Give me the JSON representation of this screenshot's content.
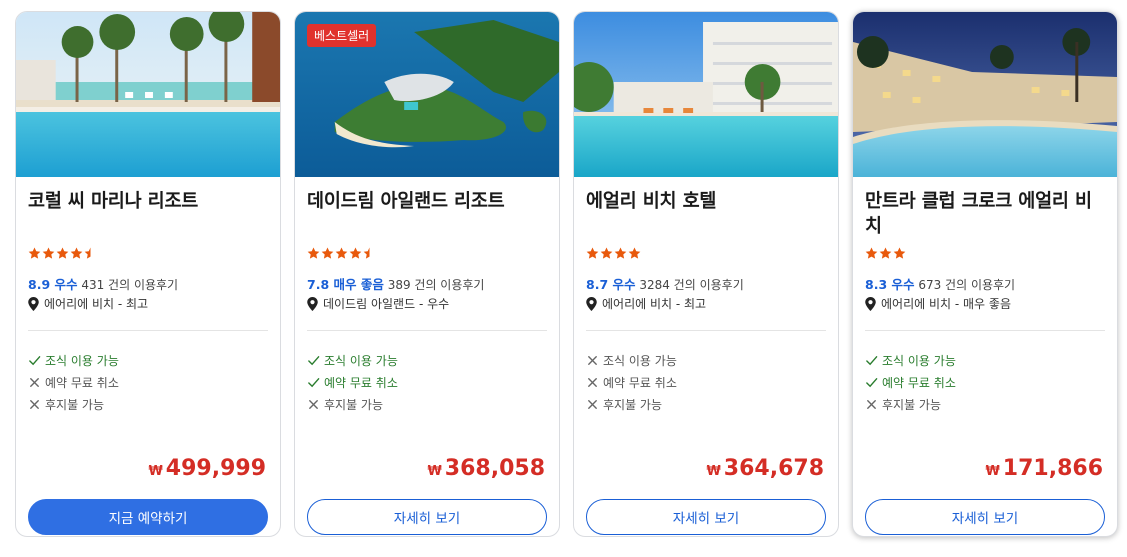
{
  "colors": {
    "accent": "#1a5fd6",
    "price": "#d42d25",
    "star": "#e8590c",
    "ok": "#2a7d2e",
    "badge": "#e0322d"
  },
  "cards": [
    {
      "title": "코럴 씨 마리나 리조트",
      "badge": "",
      "stars": 4.5,
      "score": "8.9 우수",
      "reviews": "431 건의 이용후기",
      "location": "에어리에 비치 - 최고",
      "features": [
        {
          "icon": "check-icon",
          "label": "조식 이용 가능"
        },
        {
          "icon": "x-icon",
          "label": "예약 무료 취소"
        },
        {
          "icon": "x-icon",
          "label": "후지불 가능"
        }
      ],
      "currency": "₩",
      "price": "499,999",
      "button": "지금 예약하기"
    },
    {
      "title": "데이드림 아일랜드 리조트",
      "badge": "베스트셀러",
      "stars": 4.5,
      "score": "7.8 매우 좋음",
      "reviews": "389 건의 이용후기",
      "location": "데이드림 아일랜드 - 우수",
      "features": [
        {
          "icon": "check-icon",
          "label": "조식 이용 가능"
        },
        {
          "icon": "check-icon",
          "label": "예약 무료 취소"
        },
        {
          "icon": "x-icon",
          "label": "후지불 가능"
        }
      ],
      "currency": "₩",
      "price": "368,058",
      "button": "자세히 보기"
    },
    {
      "title": "에얼리 비치 호텔",
      "badge": "",
      "stars": 4,
      "score": "8.7 우수",
      "reviews": "3284 건의 이용후기",
      "location": "에어리에 비치 - 최고",
      "features": [
        {
          "icon": "x-icon",
          "label": "조식 이용 가능"
        },
        {
          "icon": "x-icon",
          "label": "예약 무료 취소"
        },
        {
          "icon": "x-icon",
          "label": "후지불 가능"
        }
      ],
      "currency": "₩",
      "price": "364,678",
      "button": "자세히 보기"
    },
    {
      "title": "만트라 클럽 크로크 에얼리 비치",
      "badge": "",
      "stars": 3,
      "score": "8.3 우수",
      "reviews": "673 건의 이용후기",
      "location": "에어리에 비치 - 매우 좋음",
      "features": [
        {
          "icon": "check-icon",
          "label": "조식 이용 가능"
        },
        {
          "icon": "check-icon",
          "label": "예약 무료 취소"
        },
        {
          "icon": "x-icon",
          "label": "후지불 가능"
        }
      ],
      "currency": "₩",
      "price": "171,866",
      "button": "자세히 보기"
    }
  ]
}
